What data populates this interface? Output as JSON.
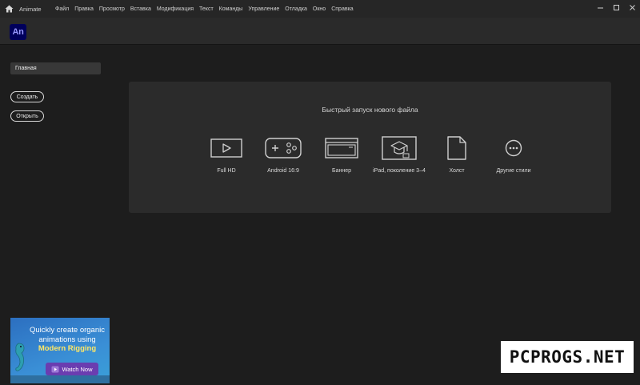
{
  "titlebar": {
    "app_name": "Animate",
    "menu": [
      "Файл",
      "Правка",
      "Просмотр",
      "Вставка",
      "Модификация",
      "Текст",
      "Команды",
      "Управление",
      "Отладка",
      "Окно",
      "Справка"
    ],
    "window_controls": [
      "minimize-icon",
      "maximize-icon",
      "close-icon"
    ]
  },
  "appbar": {
    "logo": "An"
  },
  "sidebar": {
    "home_label": "Главная",
    "create_label": "Создать",
    "open_label": "Открыть"
  },
  "quick_start": {
    "title": "Быстрый запуск нового файла",
    "presets": [
      {
        "label": "Full HD",
        "icon": "video-screen-icon"
      },
      {
        "label": "Android 16:9",
        "icon": "gamepad-icon"
      },
      {
        "label": "Баннер",
        "icon": "browser-window-icon"
      },
      {
        "label": "iPad, поколение 3–4",
        "icon": "graduation-cap-screen-icon"
      },
      {
        "label": "Холст",
        "icon": "document-icon"
      },
      {
        "label": "Другие стили",
        "icon": "more-icon"
      }
    ]
  },
  "promo": {
    "line1": "Quickly create organic animations using",
    "highlight": "Modern Rigging",
    "button": "Watch Now"
  },
  "watermark": "PCPROGS.NET",
  "colors": {
    "background": "#1d1d1d",
    "panel": "#2b2b2b",
    "logo_bg": "#00005b",
    "logo_text": "#9999ff",
    "promo_accent": "#6a3db0"
  }
}
